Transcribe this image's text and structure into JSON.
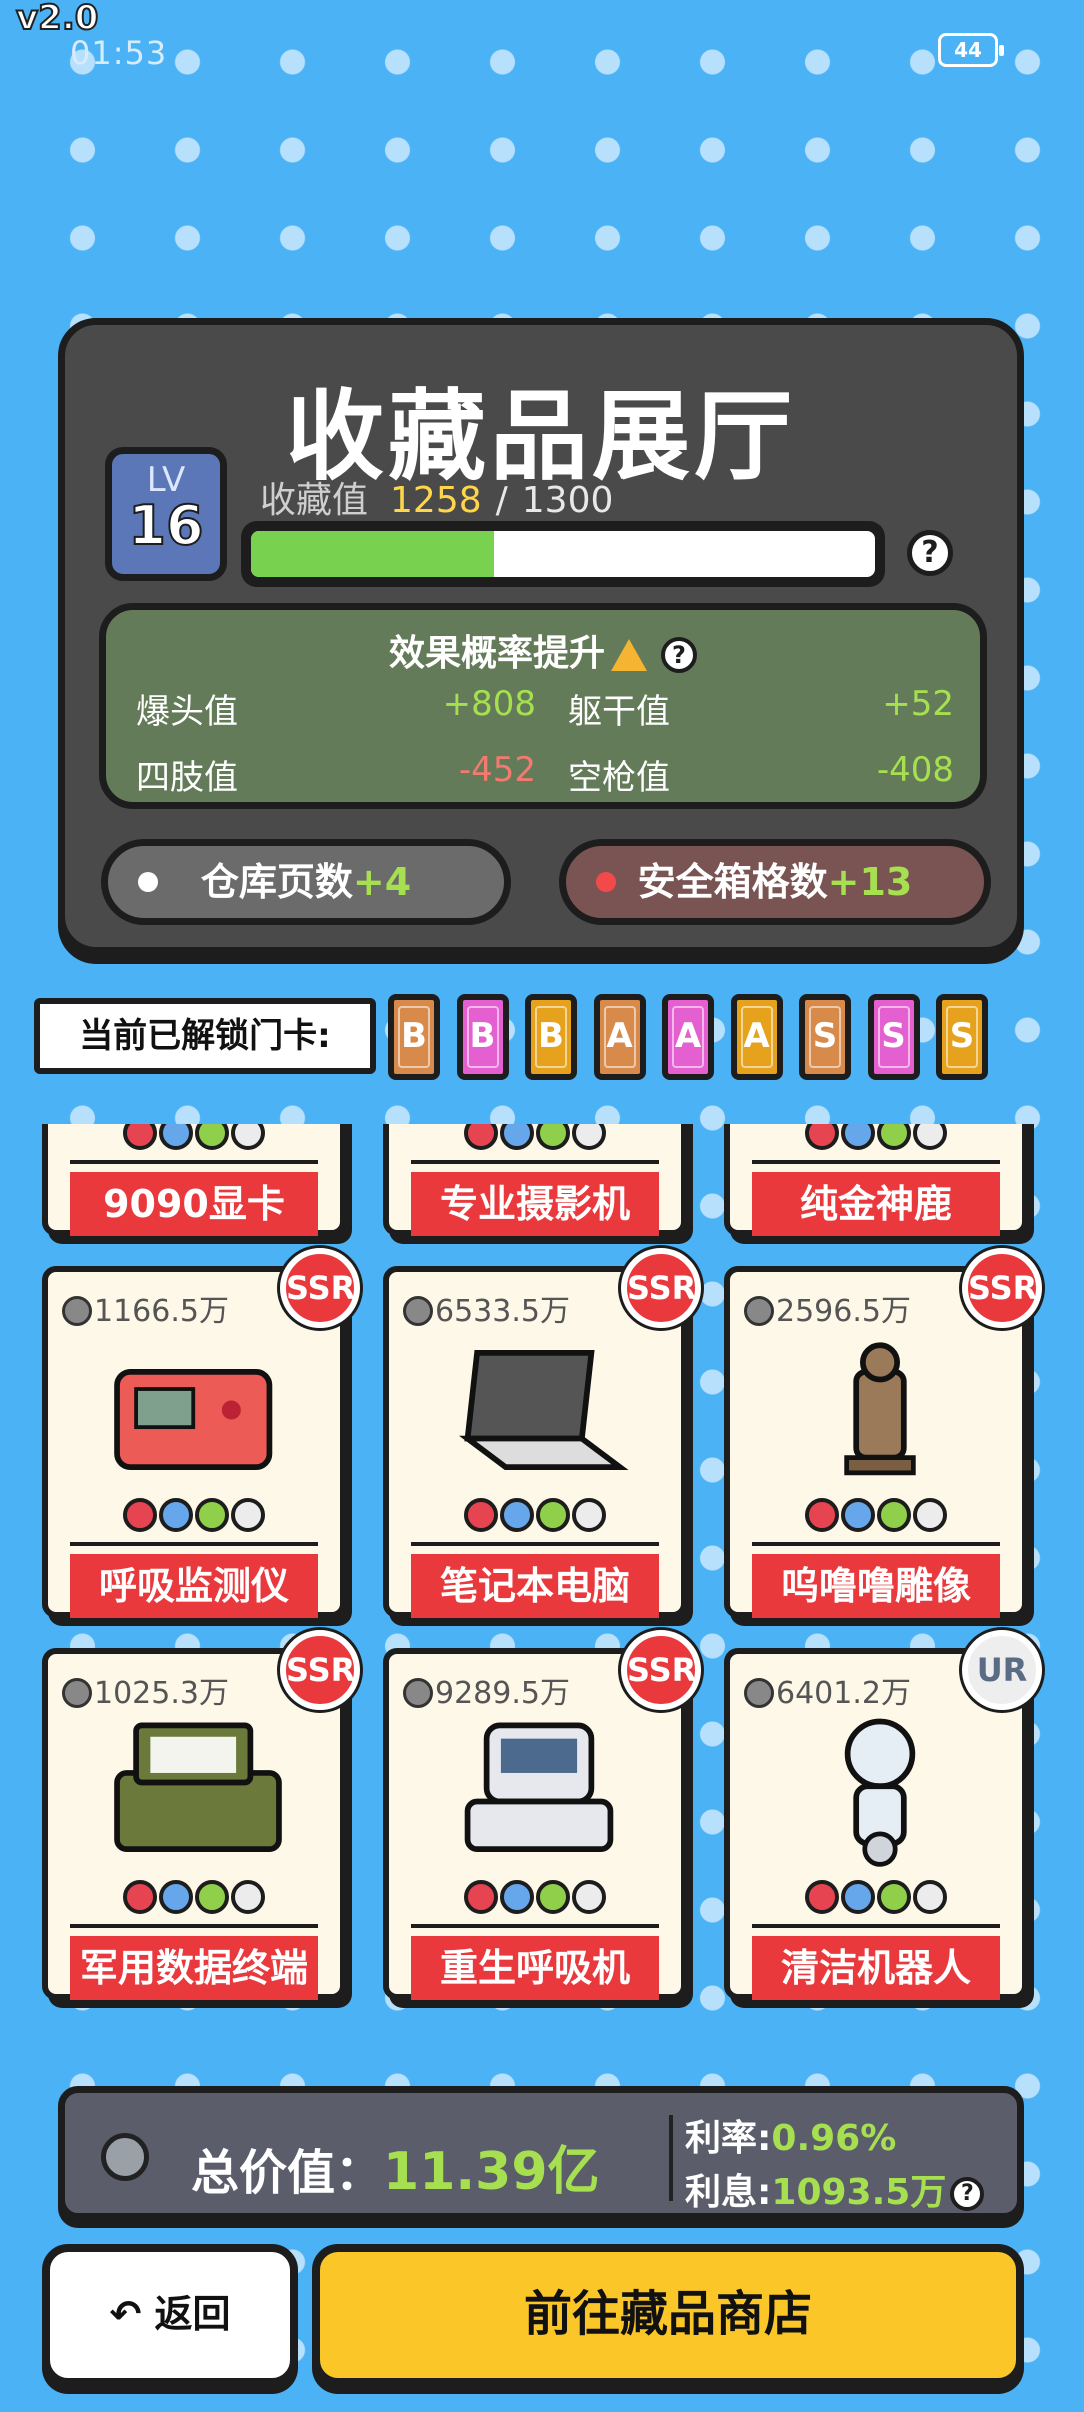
{
  "status": {
    "version": "v2.0",
    "time": "01:53",
    "battery": "44"
  },
  "hall": {
    "title": "收藏品展厅",
    "level_label": "LV",
    "level": "16",
    "xp_label": "收藏值",
    "xp_current": "1258",
    "xp_separator": "/",
    "xp_max": "1300",
    "xp_progress": 0.39,
    "help_glyph": "?"
  },
  "effect": {
    "title": "效果概率提升",
    "stats": [
      {
        "label": "爆头值",
        "value": "+808",
        "kind": "pos"
      },
      {
        "label": "躯干值",
        "value": "+52",
        "kind": "pos"
      },
      {
        "label": "四肢值",
        "value": "-452",
        "kind": "neg"
      },
      {
        "label": "空枪值",
        "value": "-408",
        "kind": "neg"
      }
    ]
  },
  "pills": {
    "warehouse_label": "仓库页数",
    "warehouse_bonus": "+4",
    "safe_label": "安全箱格数",
    "safe_bonus": "+13"
  },
  "cards": {
    "label": "当前已解锁门卡:",
    "items": [
      {
        "grade": "B",
        "color": "#d88a4a"
      },
      {
        "grade": "B",
        "color": "#e45fd0"
      },
      {
        "grade": "B",
        "color": "#e6a21c"
      },
      {
        "grade": "A",
        "color": "#d88a4a"
      },
      {
        "grade": "A",
        "color": "#e45fd0"
      },
      {
        "grade": "A",
        "color": "#e6a21c"
      },
      {
        "grade": "S",
        "color": "#d88a4a"
      },
      {
        "grade": "S",
        "color": "#e45fd0"
      },
      {
        "grade": "S",
        "color": "#e6a21c"
      }
    ]
  },
  "items": [
    {
      "name": "9090显卡",
      "price": "",
      "rarity": "",
      "icon": "graphics-card-icon"
    },
    {
      "name": "专业摄影机",
      "price": "",
      "rarity": "",
      "icon": "camera-icon"
    },
    {
      "name": "纯金神鹿",
      "price": "",
      "rarity": "",
      "icon": "golden-deer-icon"
    },
    {
      "name": "呼吸监测仪",
      "price": "1166.5万",
      "rarity": "SSR",
      "icon": "breath-monitor-icon"
    },
    {
      "name": "笔记本电脑",
      "price": "6533.5万",
      "rarity": "SSR",
      "icon": "laptop-icon"
    },
    {
      "name": "呜噜噜雕像",
      "price": "2596.5万",
      "rarity": "SSR",
      "icon": "statue-icon"
    },
    {
      "name": "军用数据终端",
      "price": "1025.3万",
      "rarity": "SSR",
      "icon": "data-terminal-icon"
    },
    {
      "name": "重生呼吸机",
      "price": "9289.5万",
      "rarity": "SSR",
      "icon": "ventilator-icon"
    },
    {
      "name": "清洁机器人",
      "price": "6401.2万",
      "rarity": "UR",
      "icon": "robot-icon"
    }
  ],
  "total": {
    "label": "总价值：",
    "value": "11.39亿",
    "rate_label": "利率:",
    "rate_value": "0.96%",
    "interest_label": "利息:",
    "interest_value": "1093.5万"
  },
  "buttons": {
    "back": "返回",
    "back_glyph": "↶",
    "shop": "前往藏品商店"
  },
  "colors": {
    "background": "#4ab2f5",
    "panel": "#4a4a4a",
    "effect_panel": "#647b5a",
    "accent_green": "#a6e050",
    "negative": "#f37a6e",
    "shop_button": "#fbc628",
    "name_plate": "#e9393d"
  }
}
